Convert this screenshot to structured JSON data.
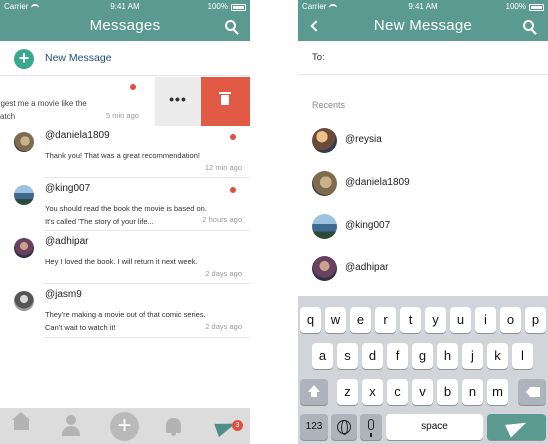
{
  "status_bar": {
    "carrier": "Carrier",
    "time": "9:41 AM",
    "battery": "100%"
  },
  "inbox": {
    "title": "Messages",
    "new_message_label": "New Message",
    "swiped_row": {
      "message_line1": "ggest me a movie like the",
      "message_line2": "vatch",
      "time": "5 min ago"
    },
    "conversations": [
      {
        "username": "@daniela1809",
        "message_line1": "Thank you! That was a great recommendation!",
        "message_line2": "",
        "time": "12 min ago",
        "unread": true
      },
      {
        "username": "@king007",
        "message_line1": "You should read the book the movie is based on.",
        "message_line2": "It's called 'The story of your life...",
        "time": "2 hours ago",
        "unread": true
      },
      {
        "username": "@adhipar",
        "message_line1": "Hey I loved the book. I will return it next week.",
        "message_line2": "",
        "time": "2 days ago",
        "unread": false
      },
      {
        "username": "@jasm9",
        "message_line1": "They're making a movie out of that comic series.",
        "message_line2": "Can't wait to watch it!",
        "time": "2 days ago",
        "unread": false
      }
    ],
    "tab_badge": "3"
  },
  "compose": {
    "title": "New Message",
    "to_label": "To:",
    "recents_heading": "Recents",
    "recents": [
      {
        "username": "@reysia"
      },
      {
        "username": "@daniela1809"
      },
      {
        "username": "@king007"
      },
      {
        "username": "@adhipar"
      }
    ]
  },
  "keyboard": {
    "row1": [
      "q",
      "w",
      "e",
      "r",
      "t",
      "y",
      "u",
      "i",
      "o",
      "p"
    ],
    "row2": [
      "a",
      "s",
      "d",
      "f",
      "g",
      "h",
      "j",
      "k",
      "l"
    ],
    "row3": [
      "z",
      "x",
      "c",
      "v",
      "b",
      "n",
      "m"
    ],
    "numbers_label": "123",
    "space_label": "space"
  },
  "colors": {
    "accent": "#5a9a90",
    "new_message_plus": "#3aa78f",
    "delete": "#e05a45",
    "unread_dot": "#e05040"
  }
}
